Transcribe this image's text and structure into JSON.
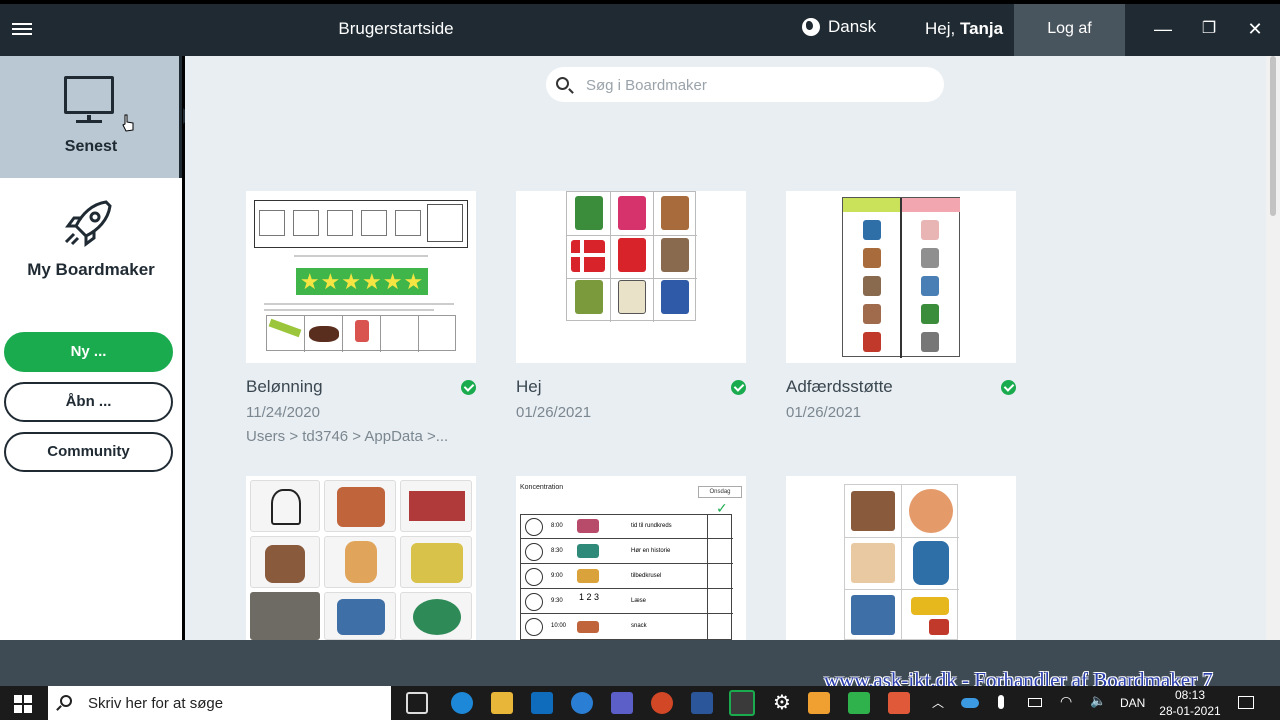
{
  "titlebar": {
    "app_title": "Brugerstartside",
    "language": "Dansk",
    "greeting_prefix": "Hej,",
    "user_name": "Tanja",
    "logout": "Log af",
    "minimize": "—",
    "restore": "❐",
    "close": "✕"
  },
  "sidebar": {
    "recent_label": "Senest",
    "mine_label": "My Boardmaker",
    "new_button": "Ny ...",
    "open_button": "Åbn ...",
    "community_button": "Community"
  },
  "search": {
    "placeholder": "Søg i Boardmaker"
  },
  "cards": [
    {
      "title": "Belønning",
      "date": "11/24/2020",
      "path": "Users > td3746 > AppData >...",
      "synced": true
    },
    {
      "title": "Hej",
      "date": "01/26/2021",
      "synced": true
    },
    {
      "title": "Adfærdsstøtte",
      "date": "01/26/2021",
      "synced": true
    }
  ],
  "thumb_text": {
    "concentration_title": "Koncentration",
    "concentration_day": "Onsdag",
    "schedule_times": [
      "8:00",
      "8:30",
      "9:00",
      "9:30",
      "10:00"
    ],
    "schedule_acts": [
      "tid til rundkreds",
      "Hør en historie",
      "tilbedkrusel",
      "Læse",
      "snack"
    ]
  },
  "watermark": "www.ask-ikt.dk - Forhandler af Boardmaker 7",
  "taskbar": {
    "search_placeholder": "Skriv her for at søge",
    "lang": "DAN",
    "time": "08:13",
    "date": "28-01-2021"
  },
  "colors": {
    "accent_green": "#1aab4f",
    "titlebar": "#1f2a33",
    "selected_nav": "#b9c8d3"
  }
}
